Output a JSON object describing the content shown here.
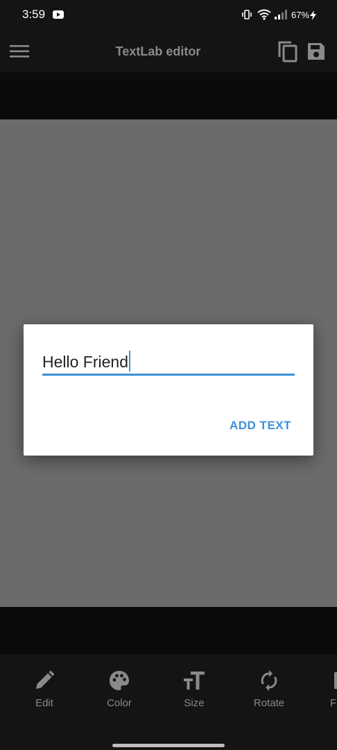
{
  "status_bar": {
    "time": "3:59",
    "battery": "67%",
    "icons": [
      "youtube-icon",
      "vibrate-icon",
      "wifi-icon",
      "signal-icon",
      "charging-bolt-icon"
    ]
  },
  "app_bar": {
    "title": "TextLab editor",
    "icons": [
      "menu-icon",
      "copy-icon",
      "save-icon"
    ]
  },
  "dialog": {
    "input_value": "Hello Friend",
    "action_label": "ADD TEXT"
  },
  "toolbar": {
    "items": [
      {
        "label": "Edit",
        "icon": "pencil-icon"
      },
      {
        "label": "Color",
        "icon": "palette-icon"
      },
      {
        "label": "Size",
        "icon": "text-size-icon"
      },
      {
        "label": "Rotate",
        "icon": "rotate-icon"
      },
      {
        "label": "F",
        "icon": "partial-icon"
      }
    ]
  },
  "colors": {
    "accent": "#3c8fd6",
    "bar_background": "#141414",
    "canvas": "#6b6b6b",
    "muted_text": "#8a8a8a"
  }
}
